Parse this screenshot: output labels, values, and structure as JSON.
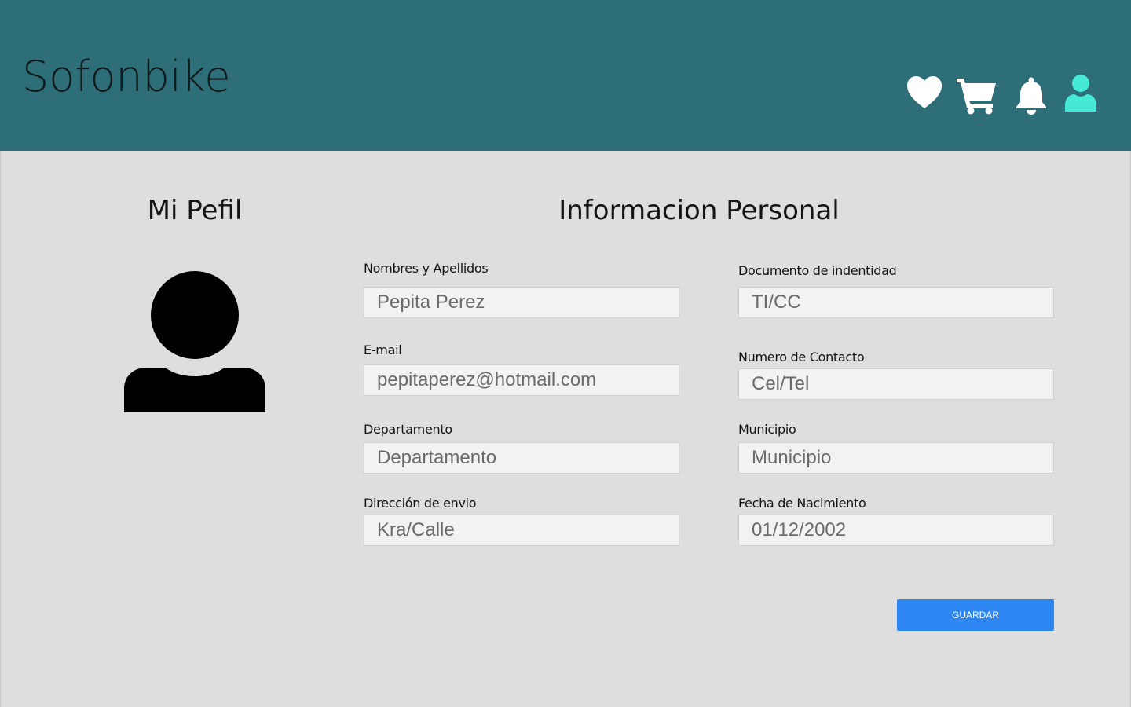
{
  "header": {
    "logo_text": "Sofonbike",
    "icons": [
      "heart-icon",
      "cart-icon",
      "bell-icon",
      "user-icon"
    ],
    "accent_color": "#46e8d6"
  },
  "profile": {
    "title": "Mi Pefil"
  },
  "form": {
    "title": "Informacion Personal",
    "fields": [
      {
        "label": "Nombres y Apellidos",
        "placeholder": "Pepita Perez"
      },
      {
        "label": "Documento de indentidad",
        "placeholder": "TI/CC"
      },
      {
        "label": "E-mail",
        "placeholder": "pepitaperez@hotmail.com"
      },
      {
        "label": "Numero de Contacto",
        "placeholder": "Cel/Tel"
      },
      {
        "label": "Departamento",
        "placeholder": "Departamento"
      },
      {
        "label": "Municipio",
        "placeholder": "Municipio"
      },
      {
        "label": "Dirección de envio",
        "placeholder": "Kra/Calle"
      },
      {
        "label": "Fecha de Nacimiento",
        "placeholder": "01/12/2002"
      }
    ],
    "save_label": "GUARDAR"
  }
}
